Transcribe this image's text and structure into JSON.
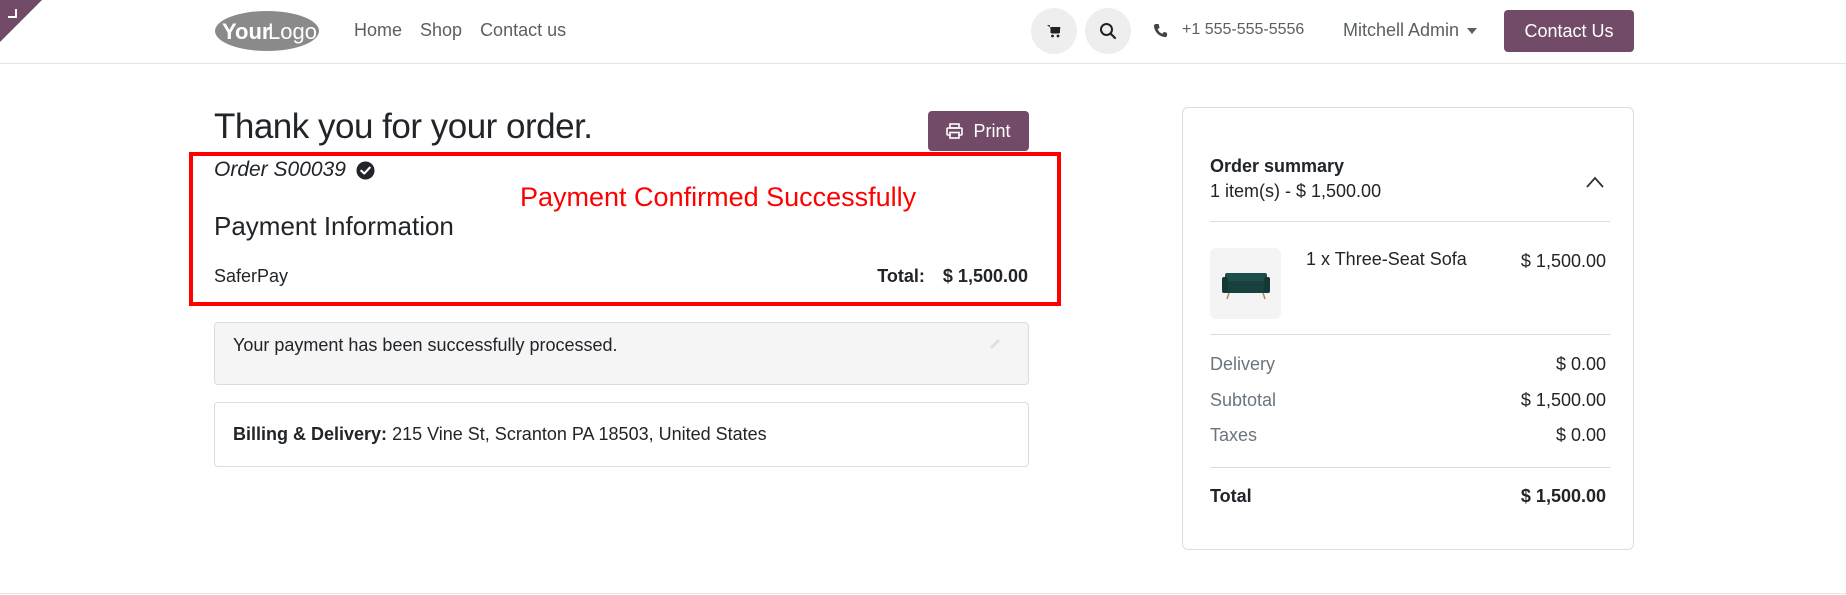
{
  "colors": {
    "brand": "#714b67",
    "highlight": "#ff0000"
  },
  "header": {
    "logo_text_bold": "Your",
    "logo_text_light": "Logo",
    "nav": [
      "Home",
      "Shop",
      "Contact us"
    ],
    "phone": "+1 555-555-5556",
    "user": "Mitchell Admin",
    "contact_button": "Contact Us"
  },
  "main": {
    "title": "Thank you for your order.",
    "print_label": "Print",
    "order_label": "Order S00039",
    "annotation": "Payment Confirmed Successfully",
    "payment_heading": "Payment Information",
    "payment_method": "SaferPay",
    "total_label": "Total:",
    "total_value": "$ 1,500.00",
    "alert_text": "Your payment has been successfully processed.",
    "billing_label": "Billing & Delivery:",
    "billing_address": "215 Vine St, Scranton PA 18503, United States"
  },
  "summary": {
    "title": "Order summary",
    "subtitle": "1 item(s) -  $ 1,500.00",
    "item_name": "1 x Three-Seat Sofa",
    "item_price": "$ 1,500.00",
    "rows": [
      {
        "label": "Delivery",
        "value": "$ 0.00"
      },
      {
        "label": "Subtotal",
        "value": "$ 1,500.00"
      },
      {
        "label": "Taxes",
        "value": "$ 0.00"
      }
    ],
    "total_label": "Total",
    "total_value": "$ 1,500.00"
  }
}
